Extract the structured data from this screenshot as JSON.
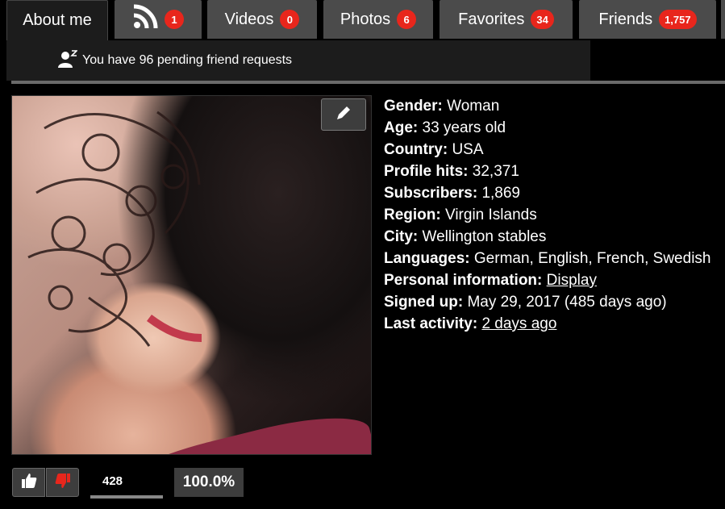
{
  "tabs": [
    {
      "label": "About me",
      "badge": null,
      "active": true
    },
    {
      "label": "",
      "icon": "rss-icon",
      "badge": "1"
    },
    {
      "label": "Videos",
      "badge": "0"
    },
    {
      "label": "Photos",
      "badge": "6"
    },
    {
      "label": "Favorites",
      "badge": "34"
    },
    {
      "label": "Friends",
      "badge": "1,757"
    }
  ],
  "pending": {
    "icon": "friend-request-icon",
    "text": "You have 96 pending friend requests"
  },
  "profile": {
    "edit_icon": "pencil-icon",
    "fields": [
      {
        "key": "Gender:",
        "value": "Woman"
      },
      {
        "key": "Age:",
        "value": "33 years old"
      },
      {
        "key": "Country:",
        "value": "USA"
      },
      {
        "key": "Profile hits:",
        "value": "32,371"
      },
      {
        "key": "Subscribers:",
        "value": "1,869"
      },
      {
        "key": "Region:",
        "value": "Virgin Islands"
      },
      {
        "key": "City:",
        "value": "Wellington stables"
      },
      {
        "key": "Languages:",
        "value": "German, English, French, Swedish"
      },
      {
        "key": "Personal information:",
        "value": "Display",
        "link": true
      },
      {
        "key": "Signed up:",
        "value": "May 29, 2017 (485 days ago)"
      },
      {
        "key": "Last activity:",
        "value": "2 days ago",
        "link": true
      }
    ]
  },
  "votes": {
    "up_icon": "thumbs-up-icon",
    "down_icon": "thumbs-down-icon",
    "count": "428",
    "rating": "100.0%"
  },
  "colors": {
    "badge": "#e8261c",
    "tab": "#4b4b4b",
    "thumb_down": "#e8261c"
  }
}
